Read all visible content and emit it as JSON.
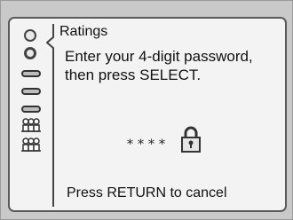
{
  "menu": {
    "title": "Ratings",
    "icons": [
      "circle-icon",
      "circle-selected-icon",
      "pill-icon",
      "pill-icon",
      "pill-icon",
      "people-icon",
      "people-icon"
    ]
  },
  "dialog": {
    "message_line1": "Enter your 4-digit password,",
    "message_line2": "then press SELECT.",
    "password_mask": "****",
    "lock_icon": "padlock-icon",
    "cancel_hint": "Press RETURN to cancel"
  },
  "colors": {
    "background": "#f3f3f3",
    "frame": "#5a5a5a",
    "text": "#111111"
  }
}
